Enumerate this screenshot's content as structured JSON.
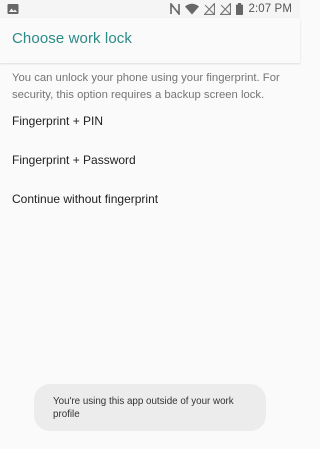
{
  "status_bar": {
    "time": "2:07 PM",
    "icons": [
      "image-notification-icon",
      "nfc-icon",
      "wifi-icon",
      "signal-icon",
      "signal-2-icon",
      "battery-icon"
    ]
  },
  "appbar": {
    "title": "Choose work lock",
    "accent_color": "#2b8b86"
  },
  "description": "You can unlock your phone using your fingerprint. For security, this option requires a backup screen lock.",
  "options": [
    {
      "label": "Fingerprint + PIN"
    },
    {
      "label": "Fingerprint + Password"
    },
    {
      "label": "Continue without fingerprint"
    }
  ],
  "toast": {
    "text": "You're using this app outside of your work profile"
  }
}
